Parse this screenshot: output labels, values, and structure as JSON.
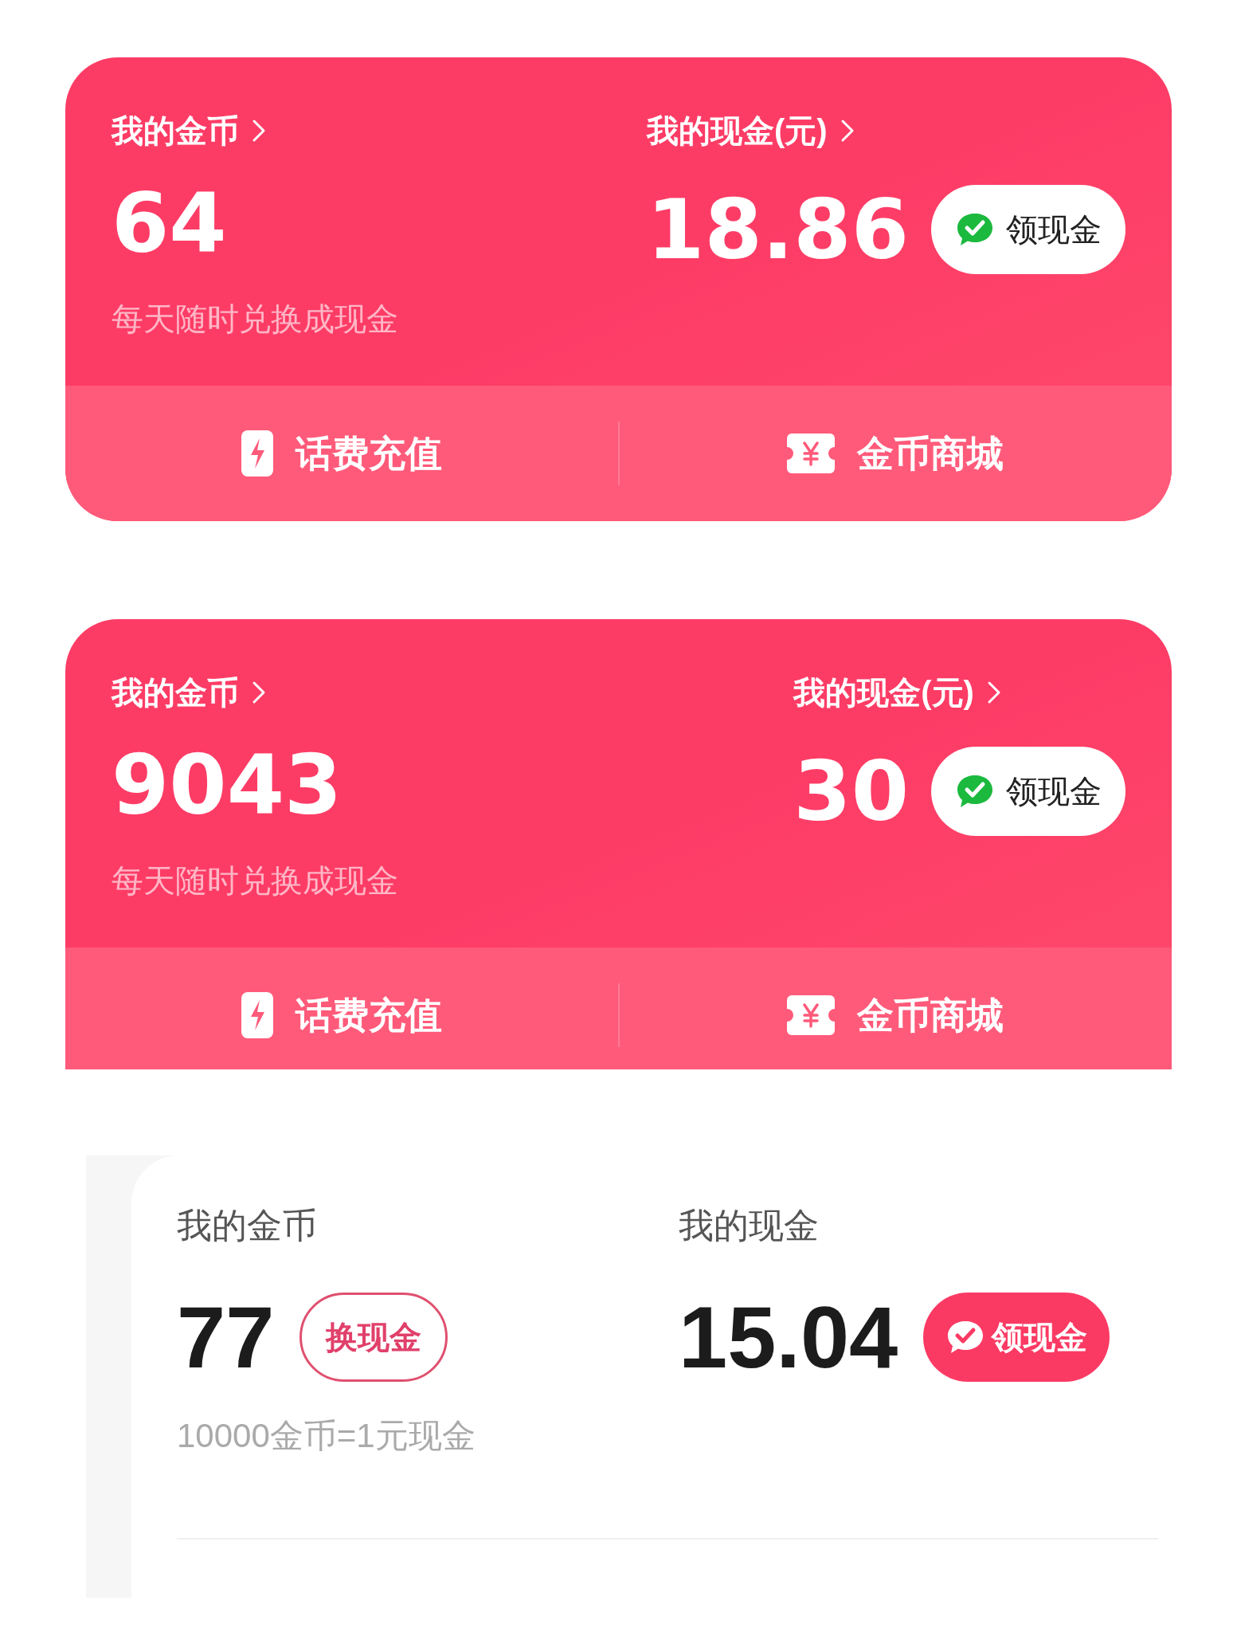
{
  "cards": [
    {
      "kind": "banner",
      "coins": {
        "label": "我的金币",
        "value": "64"
      },
      "cash": {
        "label": "我的现金(元)",
        "value": "18.86",
        "button": "领现金"
      },
      "note": "每天随时兑换成现金",
      "actions": [
        {
          "kind": "bolt",
          "label": "话费充值"
        },
        {
          "kind": "ticket",
          "label": "金币商城"
        }
      ]
    },
    {
      "kind": "banner",
      "coins": {
        "label": "我的金币",
        "value": "9043"
      },
      "cash": {
        "label": "我的现金(元)",
        "value": "30",
        "button": "领现金"
      },
      "note": "每天随时兑换成现金",
      "actions": [
        {
          "kind": "bolt",
          "label": "话费充值"
        },
        {
          "kind": "ticket",
          "label": "金币商城"
        }
      ]
    },
    {
      "kind": "plain",
      "coins": {
        "label": "我的金币",
        "value": "77",
        "button": "换现金"
      },
      "cash": {
        "label": "我的现金",
        "value": "15.04",
        "button": "领现金"
      },
      "note": "10000金币=1元现金"
    }
  ]
}
